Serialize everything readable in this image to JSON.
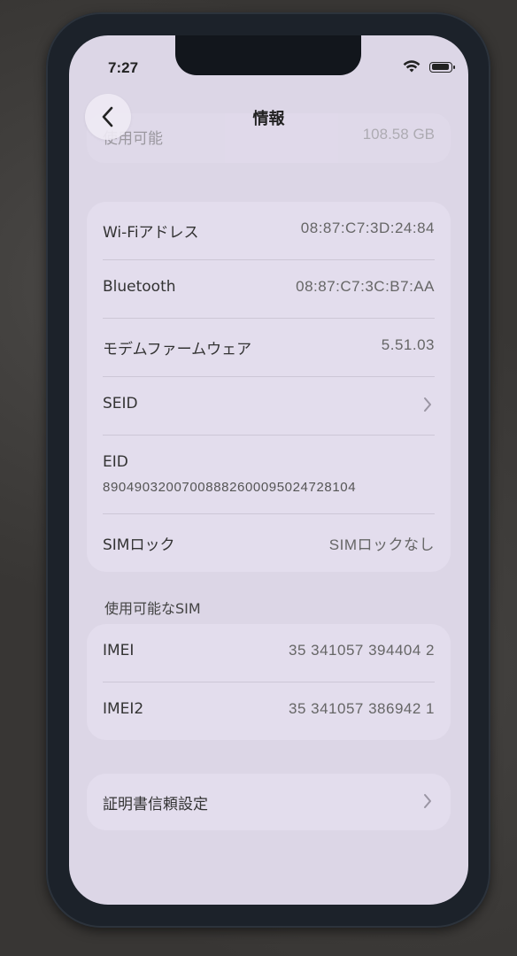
{
  "status_bar": {
    "time": "7:27"
  },
  "nav": {
    "title": "情報"
  },
  "faded_row": {
    "label": "使用可能",
    "value": "108.58 GB"
  },
  "network_rows": [
    {
      "label": "Wi-Fiアドレス",
      "value": "08:87:C7:3D:24:84"
    },
    {
      "label": "Bluetooth",
      "value": "08:87:C7:3C:B7:AA"
    },
    {
      "label": "モデムファームウェア",
      "value": "5.51.03"
    },
    {
      "label": "SEID",
      "value": ""
    }
  ],
  "eid": {
    "label": "EID",
    "value": "89049032007008882600095024728104"
  },
  "sim_lock": {
    "label": "SIMロック",
    "value": "SIMロックなし"
  },
  "sim_section": {
    "header": "使用可能なSIM",
    "rows": [
      {
        "label": "IMEI",
        "value": "35 341057 394404 2"
      },
      {
        "label": "IMEI2",
        "value": "35 341057 386942 1"
      }
    ]
  },
  "cert_trust": {
    "label": "証明書信頼設定"
  }
}
